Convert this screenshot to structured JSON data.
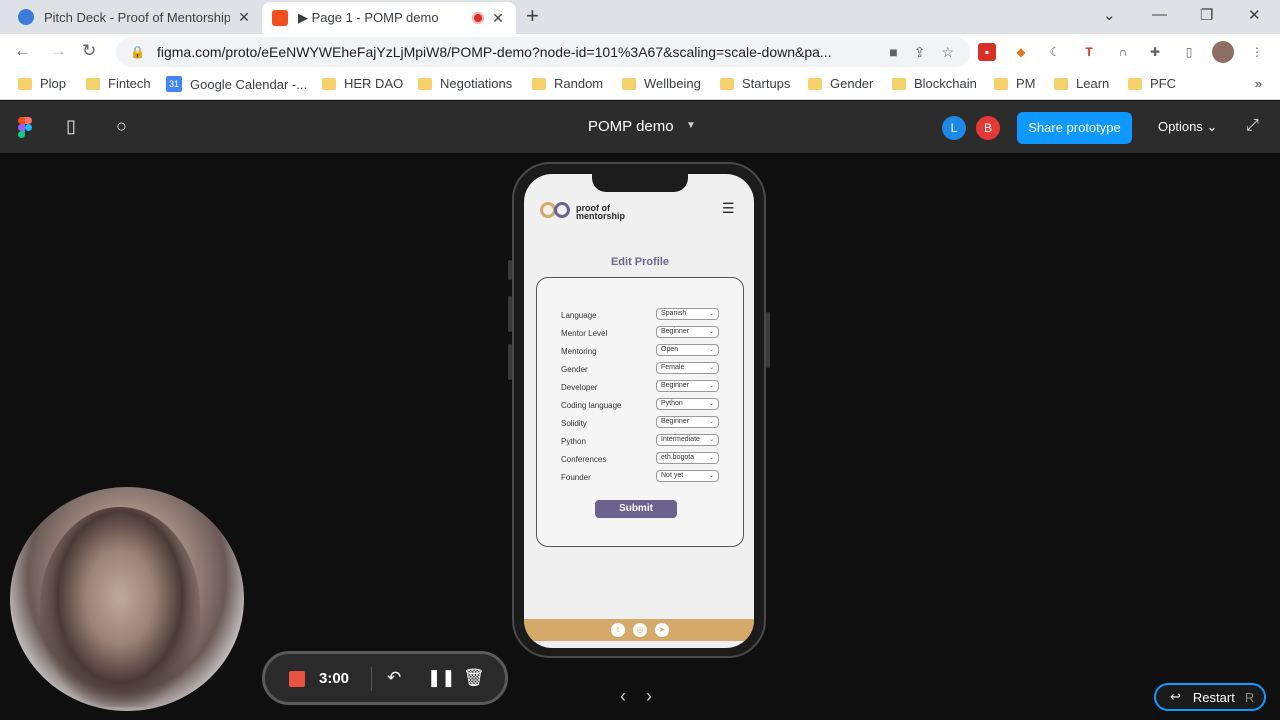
{
  "browser": {
    "tabs": [
      {
        "title": "Pitch Deck - Proof of Mentorship",
        "close": "✕"
      },
      {
        "title": "▶ Page 1 - POMP demo",
        "close": "✕"
      }
    ],
    "new_tab": "+",
    "url": "figma.com/proto/eEeNWYWEheFajYzLjMpiW8/POMP-demo?node-id=101%3A67&scaling=scale-down&pa...",
    "bookmarks": [
      "Plop",
      "Fintech",
      "Google Calendar -...",
      "HER DAO",
      "Negotiations",
      "Random",
      "Wellbeing",
      "Startups",
      "Gender",
      "Blockchain",
      "PM",
      "Learn",
      "PFC"
    ],
    "bookmarks_more": "»"
  },
  "figma": {
    "title": "POMP demo",
    "avatars": [
      "L",
      "B"
    ],
    "share_label": "Share prototype",
    "options_label": "Options"
  },
  "app": {
    "logo_line1": "proof of",
    "logo_line2": "mentorship",
    "page_title": "Edit Profile",
    "fields": [
      {
        "label": "Language",
        "value": "Spanish"
      },
      {
        "label": "Mentor Level",
        "value": "Beginner"
      },
      {
        "label": "Mentoring",
        "value": "Open"
      },
      {
        "label": "Gender",
        "value": "Female"
      },
      {
        "label": "Developer",
        "value": "Beginner"
      },
      {
        "label": "Coding language",
        "value": "Python"
      },
      {
        "label": "Solidity",
        "value": "Beginner"
      },
      {
        "label": "Python",
        "value": "Intermediate"
      },
      {
        "label": "Conferences",
        "value": "eth.bogota"
      },
      {
        "label": "Founder",
        "value": "Not yet"
      }
    ],
    "submit_label": "Submit",
    "colors": {
      "accent": "#6b6290",
      "footer": "#d4a96a"
    }
  },
  "recorder": {
    "time": "3:00"
  },
  "restart": {
    "label": "Restart",
    "key": "R"
  }
}
